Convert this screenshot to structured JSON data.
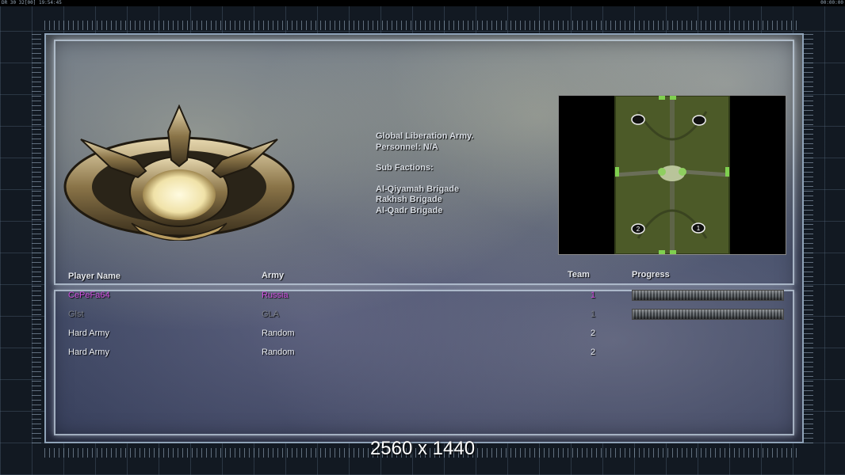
{
  "topbar": {
    "left": "DR 30 32[00] 19:54:45",
    "right": "00:00:00"
  },
  "faction": {
    "name_line": "Global Liberation Army.",
    "personnel": "Personnel: N/A",
    "sub_header": "Sub Factions:",
    "subs": [
      "Al-Qiyamah Brigade",
      "Rakhsh Brigade",
      "Al-Qadr Brigade"
    ]
  },
  "minimap": {
    "starts": [
      "2",
      "1"
    ]
  },
  "headers": {
    "player": "Player Name",
    "army": "Army",
    "team": "Team",
    "progress": "Progress"
  },
  "players": [
    {
      "name": "CePeFa64",
      "army": "Russia",
      "team": "1",
      "has_progress": true
    },
    {
      "name": "Glst",
      "army": "GLA",
      "team": "1",
      "has_progress": true
    },
    {
      "name": "Hard Army",
      "army": "Random",
      "team": "2",
      "has_progress": false
    },
    {
      "name": "Hard Army",
      "army": "Random",
      "team": "2",
      "has_progress": false
    }
  ],
  "resolution": "2560 x 1440",
  "colors": {
    "local_player": "#d050e0",
    "ally": "#7a7f88",
    "ai": "#eceff3"
  }
}
